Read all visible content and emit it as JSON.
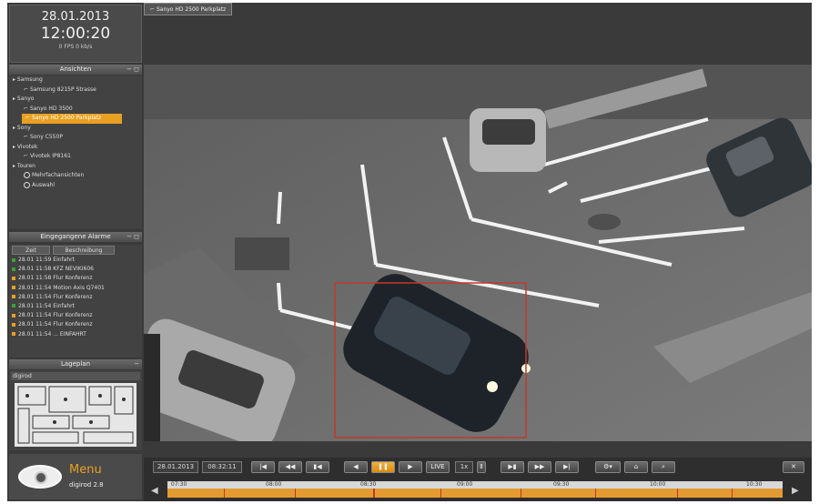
{
  "clock": {
    "date": "28.01.2013",
    "time": "12:00:20",
    "fps": "0 FPS 0 kb/s"
  },
  "title_tab": "Sanyo HD 2500 Parkplatz",
  "panels": {
    "views": "Ansichten",
    "alarms": "Eingegangene Alarme",
    "map": "Lageplan"
  },
  "views": [
    {
      "type": "group",
      "label": "Samsung"
    },
    {
      "type": "camera",
      "label": "Samsung 8215P Strasse"
    },
    {
      "type": "group",
      "label": "Sanyo"
    },
    {
      "type": "camera",
      "label": "Sanyo HD 3500"
    },
    {
      "type": "selected",
      "label": "Sanyo HD 2500 Parkplatz"
    },
    {
      "type": "group",
      "label": "Sony"
    },
    {
      "type": "camera",
      "label": "Sony C550P"
    },
    {
      "type": "group",
      "label": "Vivotek"
    },
    {
      "type": "camera",
      "label": "Vivotek IP8161"
    },
    {
      "type": "group",
      "label": "Touren"
    },
    {
      "type": "special",
      "label": "Mehrfachansichten"
    },
    {
      "type": "special",
      "label": "Auswahl"
    }
  ],
  "alarm_columns": {
    "time": "Zeit",
    "desc": "Beschreibung"
  },
  "alarms": [
    {
      "text": "28.01 11:59 Einfahrt",
      "color": "#3aa13a"
    },
    {
      "text": "28.01 11:58 KFZ NEVIKI606",
      "color": "#3aa13a"
    },
    {
      "text": "28.01 11:58 Flur Konferenz",
      "color": "#e8a022"
    },
    {
      "text": "28.01 11:54 Motion Axis Q7401",
      "color": "#e8a022"
    },
    {
      "text": "28.01 11:54 Flur Konferenz",
      "color": "#e8a022"
    },
    {
      "text": "28.01 11:54 Einfahrt",
      "color": "#3aa13a"
    },
    {
      "text": "28.01 11:54 Flur Konferenz",
      "color": "#e8a022"
    },
    {
      "text": "28.01 11:54 Flur Konferenz",
      "color": "#e8a022"
    },
    {
      "text": "28.01 11:54 ... EINFAHRT",
      "color": "#e8a022"
    }
  ],
  "map_select": "digirod",
  "menu": {
    "label": "Menu",
    "brand": "digirod 2.8"
  },
  "transport": {
    "date": "28.01.2013",
    "time": "08:32:11",
    "live": "LIVE",
    "speed": "1x",
    "ticks": [
      "07:30",
      "08:00",
      "08:30",
      "09:00",
      "09:30",
      "10:00",
      "10:30"
    ]
  },
  "colors": {
    "accent": "#e8a022",
    "timeline": "#e39a30"
  }
}
